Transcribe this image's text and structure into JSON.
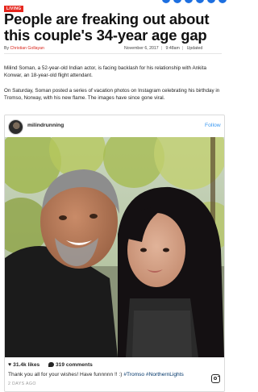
{
  "article": {
    "tag": "LIVING",
    "headline": "People are freaking out about this couple's 34-year age gap",
    "byline": {
      "prefix": "By",
      "author": "Christian Gollayan",
      "date": "November 6, 2017",
      "time": "9:48am",
      "updated": "Updated"
    },
    "paragraphs": [
      "Milind Soman, a 52-year-old Indian actor, is facing backlash for his relationship with Ankita Konwar, an 18-year-old flight attendant.",
      "On Saturday, Soman posted a series of vacation photos on Instagram celebrating his birthday in Tromso, Norway, with his new flame. The images have since gone viral."
    ]
  },
  "instagram_post": {
    "username": "milindrunning",
    "follow_label": "Follow",
    "likes": "31.4k likes",
    "comments": "319 comments",
    "caption_text": "Thank you all for your wishes! Have funnnnn !! :) ",
    "caption_hashtags": "#Tromso #NorthernLights",
    "timestamp": "2 DAYS AGO",
    "icons": [
      "heart-icon",
      "comment-icon",
      "instagram-logo-icon"
    ]
  },
  "colors": {
    "tag_red": "#e6271e",
    "author_red": "#d9261c",
    "follow_blue": "#3897f0",
    "social_blue": "#1d6fe0"
  }
}
